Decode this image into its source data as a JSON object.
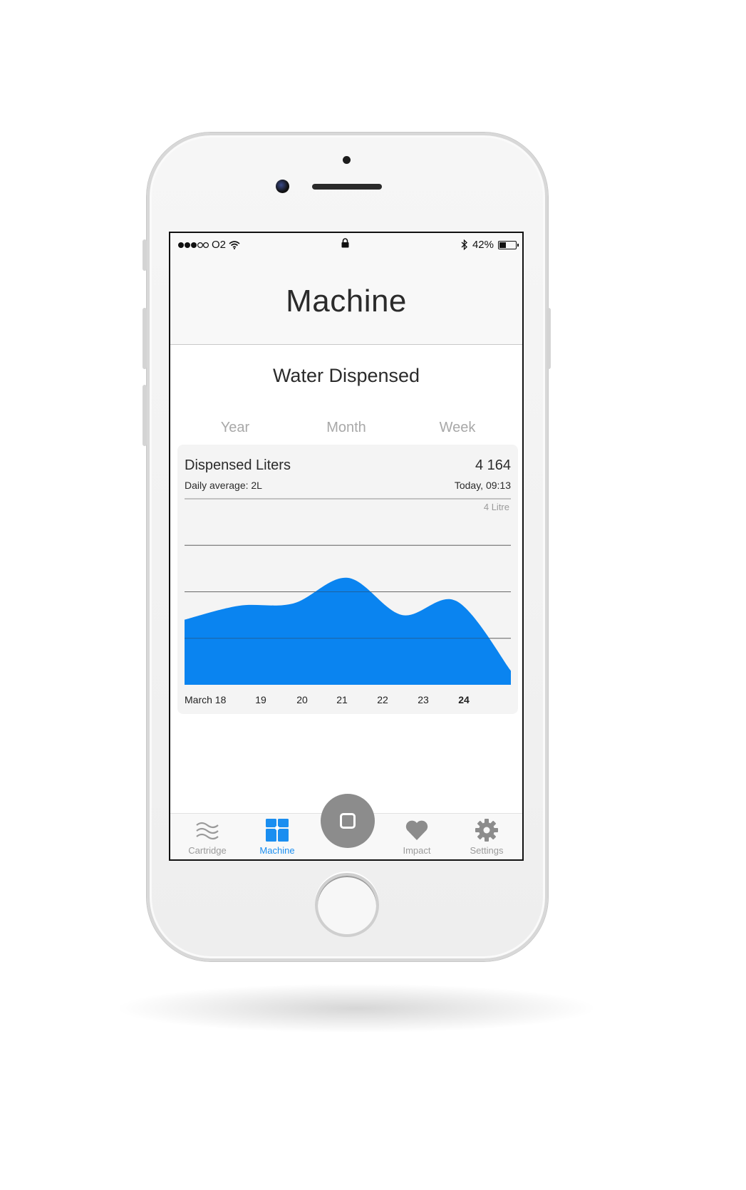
{
  "status_bar": {
    "carrier": "O2",
    "battery": "42%",
    "battery_level": 0.42
  },
  "header": {
    "title": "Machine"
  },
  "section": {
    "title": "Water Dispensed"
  },
  "tabs": [
    {
      "label": "Year",
      "active": false
    },
    {
      "label": "Month",
      "active": false
    },
    {
      "label": "Week",
      "active": true
    }
  ],
  "card": {
    "title": "Dispensed Liters",
    "value": "4 164",
    "daily_average": "Daily average: 2L",
    "updated": "Today, 09:13"
  },
  "chart_data": {
    "type": "area",
    "x": [
      "March 18",
      "19",
      "20",
      "21",
      "22",
      "23",
      "24"
    ],
    "highlighted_x": "24",
    "series": [
      {
        "values": [
          1.4,
          1.7,
          1.75,
          2.3,
          1.5,
          1.8,
          0.3
        ]
      }
    ],
    "ylim": [
      0,
      4
    ],
    "y_tick_label": "4 Litre",
    "grid": true,
    "colors": {
      "fill": "#0a84f0",
      "grid": "#8f8f8f",
      "axis_label": "#222222"
    }
  },
  "tab_bar": {
    "items": [
      {
        "label": "Cartridge",
        "icon": "waves-icon",
        "active": false
      },
      {
        "label": "Machine",
        "icon": "machine-icon",
        "active": true
      },
      {
        "label": "Impact",
        "icon": "heart-icon",
        "active": false
      },
      {
        "label": "Settings",
        "icon": "gear-icon",
        "active": false
      }
    ],
    "center_button_icon": "square-icon",
    "colors": {
      "active": "#1a8ef0",
      "inactive": "#9a9a9a"
    }
  }
}
